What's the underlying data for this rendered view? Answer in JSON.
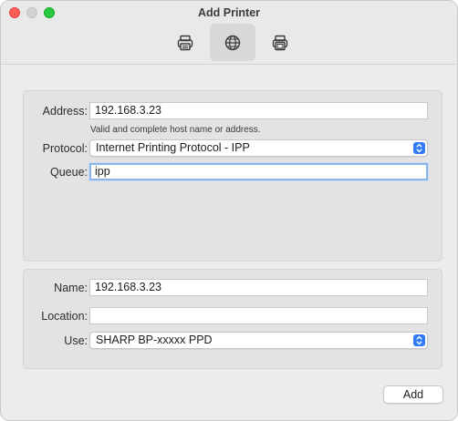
{
  "window": {
    "title": "Add Printer",
    "toolbar": [
      {
        "icon": "printer-icon",
        "selected": false
      },
      {
        "icon": "globe-icon",
        "selected": true
      },
      {
        "icon": "windows-printer-icon",
        "selected": false
      }
    ]
  },
  "connection": {
    "address_label": "Address:",
    "address_value": "192.168.3.23",
    "address_hint": "Valid and complete host name or address.",
    "protocol_label": "Protocol:",
    "protocol_value": "Internet Printing Protocol - IPP",
    "queue_label": "Queue:",
    "queue_value": "ipp"
  },
  "printer_info": {
    "name_label": "Name:",
    "name_value": "192.168.3.23",
    "location_label": "Location:",
    "location_value": "",
    "use_label": "Use:",
    "use_value": "SHARP BP-xxxxx PPD"
  },
  "footer": {
    "add_label": "Add"
  },
  "colors": {
    "accent": "#2f7cf6",
    "close": "#ff5f57",
    "minimize": "#d3d3d3",
    "zoom": "#28c840",
    "focus_ring": "#8bb4e8"
  }
}
